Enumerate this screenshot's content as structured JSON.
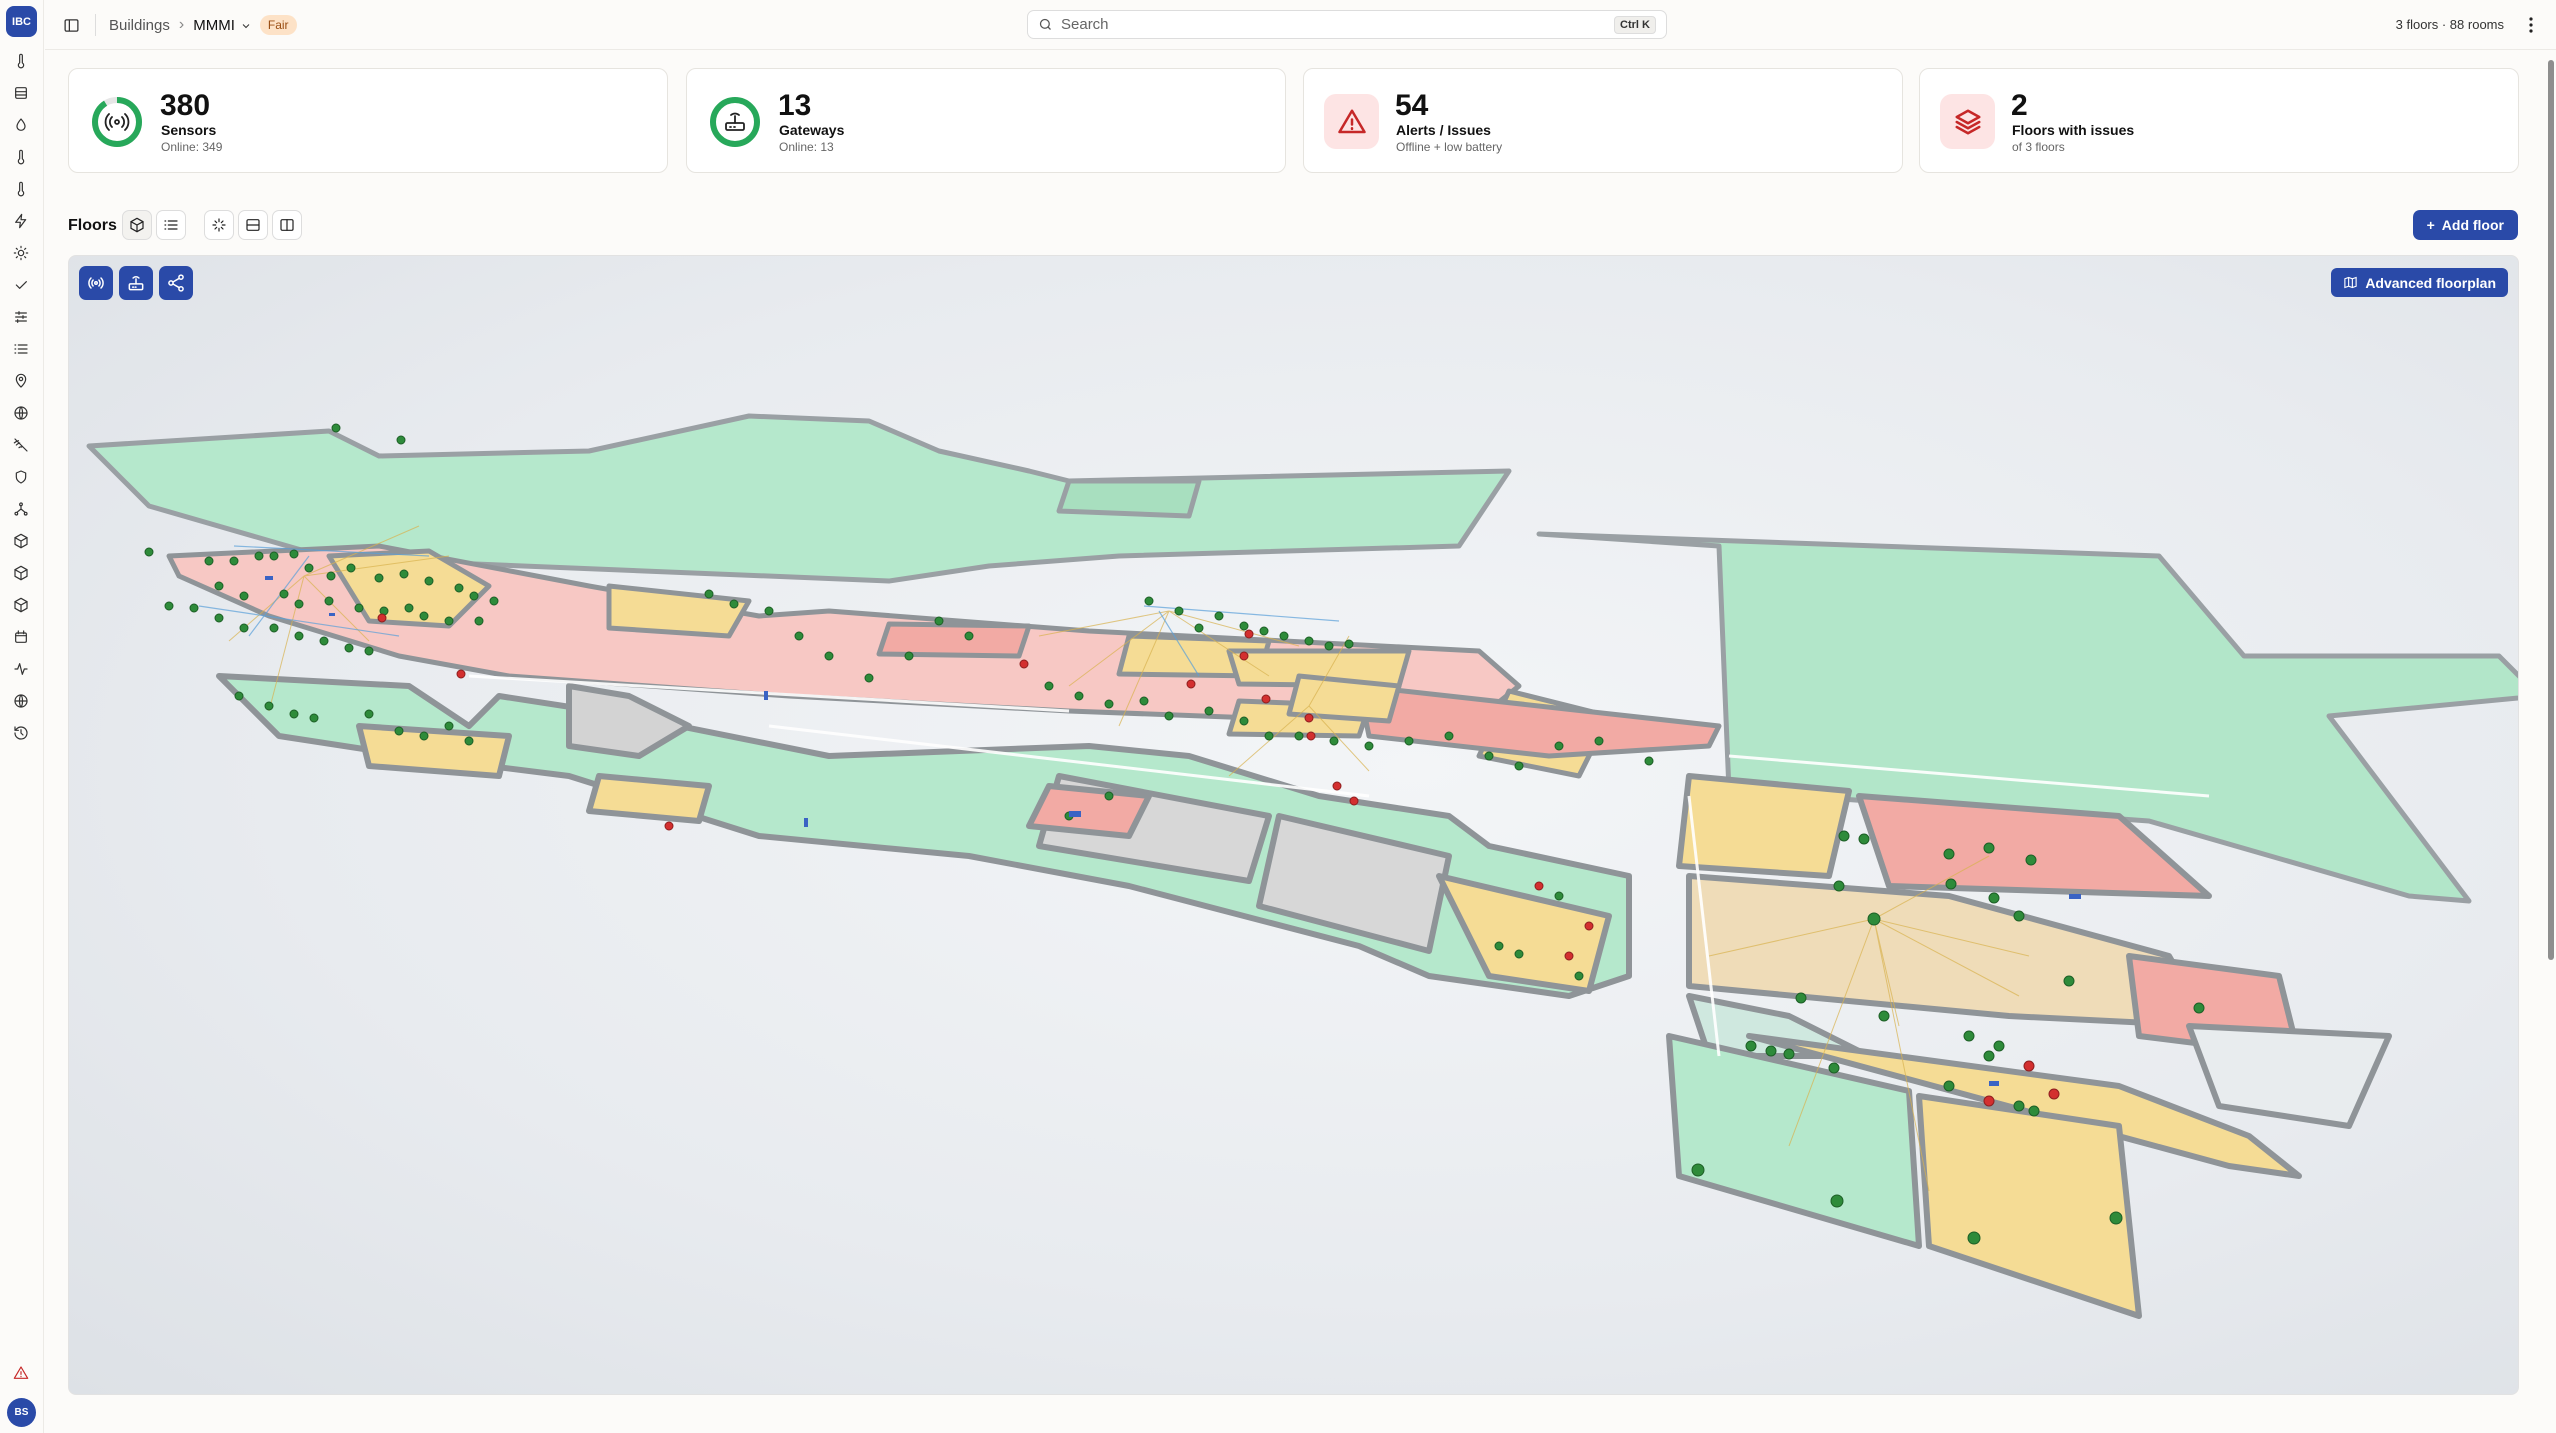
{
  "app": {
    "logo_text": "IBC",
    "avatar_initials": "BS"
  },
  "header": {
    "breadcrumbs": [
      "Buildings",
      "MMMI"
    ],
    "status_badge": "Fair",
    "search": {
      "placeholder": "Search",
      "shortcut": "Ctrl K"
    },
    "summary": "3 floors · 88 rooms"
  },
  "stats": [
    {
      "value": "380",
      "label": "Sensors",
      "sub": "Online: 349",
      "icon": "sensor-icon"
    },
    {
      "value": "13",
      "label": "Gateways",
      "sub": "Online: 13",
      "icon": "router-icon"
    },
    {
      "value": "54",
      "label": "Alerts / Issues",
      "sub": "Offline + low battery",
      "icon": "warning-icon"
    },
    {
      "value": "2",
      "label": "Floors with issues",
      "sub": "of 3 floors",
      "icon": "layers-icon"
    }
  ],
  "floors": {
    "title": "Floors",
    "add_label": "Add floor",
    "advanced_label": "Advanced floorplan"
  },
  "colors": {
    "accent": "#2a4aa8",
    "ok": "#27a85a",
    "warn_badge": "#fde2c7",
    "room_green": "#a8e6c4",
    "room_yellow": "#f5dc95",
    "room_red": "#f4a7a2",
    "room_grey": "#d6d6d6",
    "sensor_ok": "#2e8b3a",
    "sensor_bad": "#d32f2f"
  }
}
